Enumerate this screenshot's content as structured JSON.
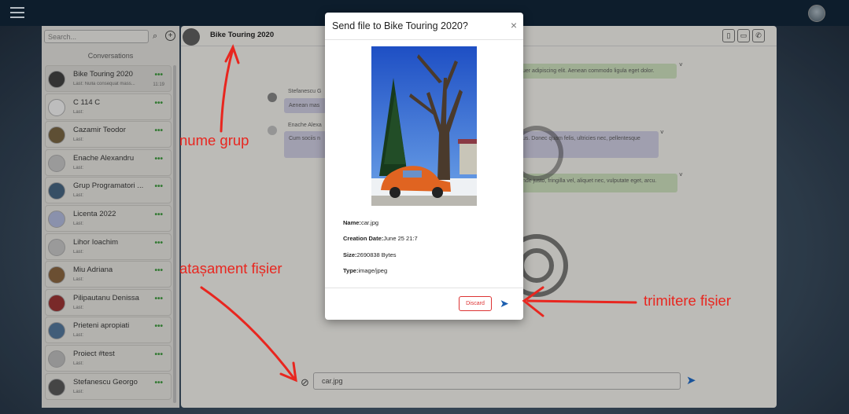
{
  "topbar": {
    "menu_icon": "hamburger-menu-icon",
    "avatar": "user-avatar"
  },
  "sidebar": {
    "search_placeholder": "Search...",
    "conversations_title": "Conversations",
    "items": [
      {
        "name": "Bike Touring 2020",
        "last": "Last: Nulla consequat mass...",
        "time": "11:19"
      },
      {
        "name": "C 114 C",
        "last": "Last:"
      },
      {
        "name": "Cazamir Teodor",
        "last": "Last:"
      },
      {
        "name": "Enache Alexandru",
        "last": "Last:"
      },
      {
        "name": "Grup Programatori ...",
        "last": "Last:"
      },
      {
        "name": "Licenta 2022",
        "last": "Last:"
      },
      {
        "name": "Lihor Ioachim",
        "last": "Last:"
      },
      {
        "name": "Miu Adriana",
        "last": "Last:"
      },
      {
        "name": "Pilipautanu Denissa",
        "last": "Last:"
      },
      {
        "name": "Prieteni apropiati",
        "last": "Last:"
      },
      {
        "name": "Proiect #test",
        "last": "Last:"
      },
      {
        "name": "Stefanescu Georgo",
        "last": "Last:"
      }
    ],
    "dots": "•••"
  },
  "chat": {
    "title": "Bike Touring 2020",
    "messages": [
      {
        "text": "uer adipiscing elit. Aenean commodo ligula eget dolor."
      },
      {
        "sender": "Stefanescu G",
        "text": "Aenean mas"
      },
      {
        "sender": "Enache Alexa",
        "text": "Cum sociis n"
      },
      {
        "text": "us. Donec quam felis, ultricies nec, pellentesque"
      },
      {
        "text": "nde justo, fringilla vel, aliquet nec, vulputate eget, arcu."
      }
    ],
    "input_value": "car.jpg"
  },
  "modal": {
    "title": "Send file to Bike Touring 2020?",
    "close": "×",
    "name_label": "Name:",
    "name_value": "car.jpg",
    "date_label": "Creation Date:",
    "date_value": "June 25 21:7",
    "size_label": "Size:",
    "size_value": "2690838 Bytes",
    "type_label": "Type:",
    "type_value": "image/jpeg",
    "discard_label": "Discard"
  },
  "annotations": {
    "group_name": "nume grup",
    "attachment": "atașament fișier",
    "send_file": "trimitere fișier"
  },
  "colors": {
    "accent": "#1d5fb0",
    "annotation": "#e8261f",
    "topbar": "#0f2233",
    "discard": "#dd3333"
  }
}
